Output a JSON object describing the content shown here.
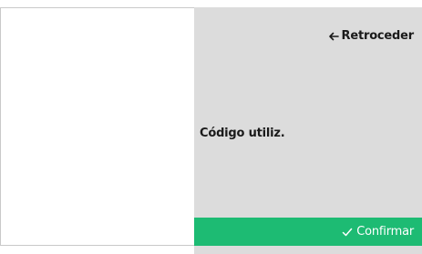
{
  "navigation": {
    "back_label": "Retroceder",
    "back_icon": "arrow-left-icon"
  },
  "content": {
    "code_label": "Código utiliz."
  },
  "actions": {
    "confirm_label": "Confirmar",
    "confirm_icon": "checkmark-icon"
  },
  "colors": {
    "panel_background": "#dcdcdc",
    "confirm_background": "#1dbb73",
    "confirm_text": "#ffffff",
    "text": "#1a1a1a"
  }
}
